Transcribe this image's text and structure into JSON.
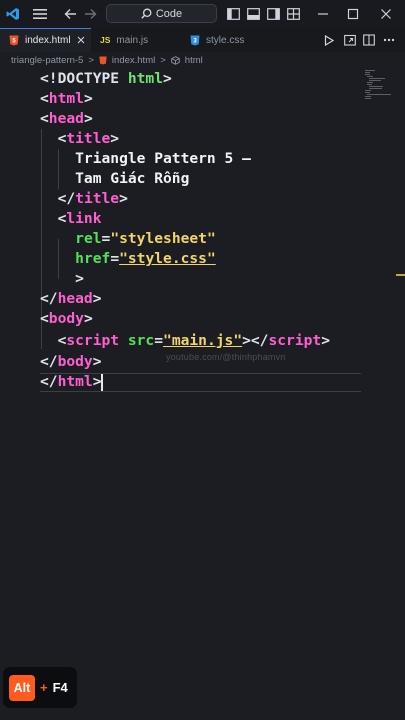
{
  "titlebar": {
    "search_label": "Code"
  },
  "tabs": [
    {
      "badge": "5",
      "label": "index.html",
      "active": true
    },
    {
      "badge": "JS",
      "label": "main.js",
      "active": false
    },
    {
      "badge": "3",
      "label": "style.css",
      "active": false
    }
  ],
  "breadcrumb": {
    "folder": "triangle-pattern-5",
    "sep1": ">",
    "file": "index.html",
    "sep2": ">",
    "element": "html"
  },
  "code": {
    "lines": [
      [
        "<!DOCTYPE",
        " html",
        ">"
      ],
      [
        "<",
        "html",
        ">"
      ],
      [
        "<",
        "head",
        ">"
      ],
      [
        "  <",
        "title",
        ">"
      ],
      [
        "    Triangle Pattern 5 –"
      ],
      [
        "    Tam Giác Rỗng"
      ],
      [
        "  </",
        "title",
        ">"
      ],
      [
        "  <",
        "link"
      ],
      [
        "    ",
        "rel",
        "=",
        "\"stylesheet\""
      ],
      [
        "    ",
        "href",
        "=",
        "\"style.css\""
      ],
      [
        "    >"
      ],
      [
        "</",
        "head",
        ">"
      ],
      [
        "<",
        "body",
        ">"
      ],
      [
        "  <",
        "script",
        " src",
        "=",
        "\"main.js\"",
        "></",
        "script",
        ">"
      ],
      [
        "</",
        "body",
        ">"
      ],
      [
        "</",
        "html",
        ">"
      ]
    ]
  },
  "watermark": "youtube.com/@thinhphamvn",
  "shortcut": {
    "key1": "Alt",
    "plus": "+",
    "key2": "F4"
  },
  "colors": {
    "tag": "#ff5fd1",
    "attribute": "#56e05a",
    "string": "#f2d46a",
    "accent_alt": "#ff5a1f"
  }
}
